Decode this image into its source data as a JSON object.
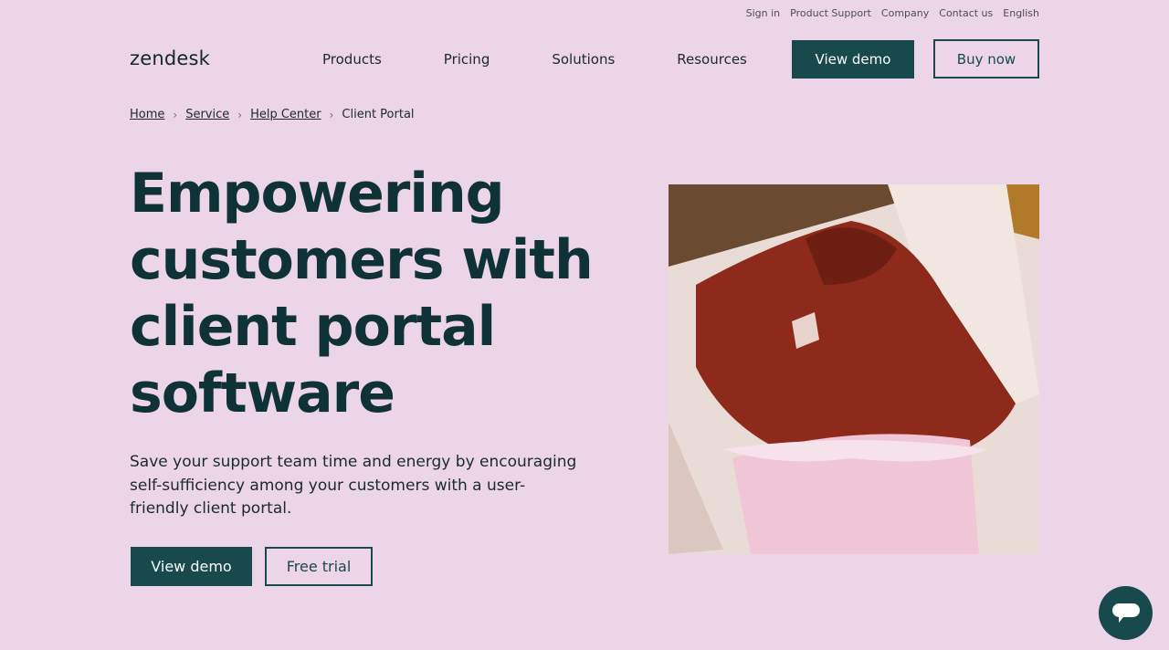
{
  "utility_nav": [
    "Sign in",
    "Product Support",
    "Company",
    "Contact us",
    "English"
  ],
  "logo": "zendesk",
  "main_nav": [
    "Products",
    "Pricing",
    "Solutions",
    "Resources"
  ],
  "header_buttons": {
    "view_demo": "View demo",
    "buy_now": "Buy now"
  },
  "breadcrumb": {
    "items": [
      "Home",
      "Service",
      "Help Center"
    ],
    "current": "Client Portal"
  },
  "hero": {
    "title": "Empowering customers with client portal software",
    "subtitle": "Save your support team time and energy by encouraging self-sufficiency among your customers with a user-friendly client portal.",
    "primary_button": "View demo",
    "secondary_button": "Free trial",
    "image_alt": "Red knit sweater folded in a pink gift box with tissue paper"
  },
  "colors": {
    "background": "#ecd5e6",
    "brand": "#17494d"
  },
  "chat_widget": {
    "icon": "chat-bubble-icon"
  }
}
